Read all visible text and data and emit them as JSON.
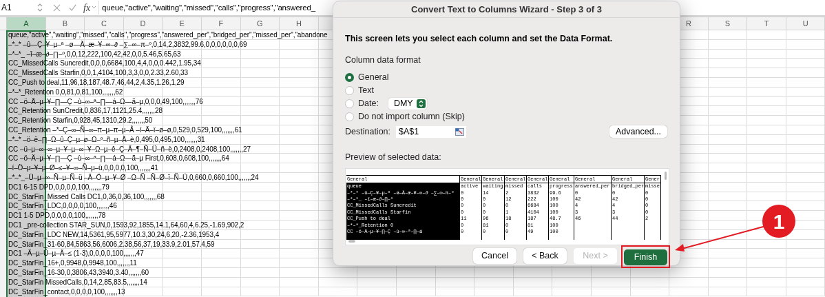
{
  "formula_bar": {
    "name_box": "A1",
    "function_label": "fx",
    "formula": "queue,\"active\",\"waiting\",\"missed\",\"calls\",\"progress\",\"answered_"
  },
  "sheet": {
    "left_columns": [
      {
        "label": "A",
        "selected": true
      },
      {
        "label": "B",
        "selected": false
      },
      {
        "label": "C",
        "selected": false
      },
      {
        "label": "D",
        "selected": false
      },
      {
        "label": "E",
        "selected": false
      },
      {
        "label": "F",
        "selected": false
      },
      {
        "label": "G",
        "selected": false
      },
      {
        "label": "H",
        "selected": false
      }
    ],
    "right_columns": [
      {
        "label": "R",
        "selected": false
      },
      {
        "label": "S",
        "selected": false
      },
      {
        "label": "T",
        "selected": false
      },
      {
        "label": "U",
        "selected": false
      }
    ],
    "rows": [
      "queue,\"active\",\"waiting\",\"missed\",\"calls\",\"progress\",\"answered_per\",\"bridged_per\",\"missed_per\",\"abandone",
      "–*–* –û—Ç–¥–µ–ª –ø—Ä–æ–¥–∞–∂ –∑–∞–π–º,0,14,2,3832,99.6,0,0,0,0,0,0,69",
      "–*–*_ –î–æ–∂–∏–º,0,0,12,222,100,42,42,0,0,5.46,5.65,63",
      "CC_MissedCalls Suncredit,0,0,0,6684,100,4,4,0,0,0.442,1.95,34",
      "CC_MissedCalls Starfin,0,0,1,4104,100,3,3,0,0,2.33,2.60,33",
      "CC_Push to deal,11,96,18,187,48.7,46,44,2,4.35,1.26,1,29",
      "–*–*_Retention 0,0,81,0,81,100,,,,,,,62",
      "CC –ö–Ä–µ–¥–∏—Ç –ù–∞–ª–∏—á–Ω—ã–µ,0,0,0,49,100,,,,,,,76",
      "CC_Retention SunCredit,0,836,17,1121,25.4,,,,,,,28",
      "CC_Retention  Starfin,0,928,45,1310,29.2,,,,,,,50",
      "CC_Retention –*–Ç–∞–Ñ–∞–π–µ–π–µ–Å –í–Ä–ï–ø–ø,0,529,0,529,100,,,,,,,61",
      "–*–* –ö–ë–∏–Ω–û–Ç–µ–ø–Ω–º–ñ–µ–Ä–è,0,495,0,495,100,,,,,,,31",
      "CC –ü–µ–∞–∞–µ–¥–µ–∞–¥–Ω–µ–ê–Ç–Ä–¶–Ñ–Ü–ñ–è,0,2408,0,2408,100,,,,,,,27",
      "CC –ö–Ä–µ–¥–∏—Ç –ù–∞–ª–∏—á–Ω—ã–µ First,0,608,0,608,100,,,,,,,64",
      "–í–Ö–µ–¥–µ–Ø–≤–¥–∞–Ñ–µ–ü,0,0,0,0,100,,,,,,,41",
      "–*–*_–Ü–µ–∞–Ñ–µ–Ñ–ü –Ä–Ö–µ–¥–Ø –Ω–Ñ –Ñ–Ø–ï–Ñ–Ü,0,660,0,660,100,,,,,,,24",
      "DC1 6-15 DPD,0,0,0,0,100,,,,,,,79",
      "DC_StarFin_Missed Calls DC1,0,36,0,36,100,,,,,,,68",
      "DC_StarFin_LDC,0,0,0,0,100,,,,,,,46",
      "DC1 1-5 DPD,0,0,0,0,100,,,,,,,78",
      "DC1 _pre-collection STAR_SUN,0,1593,92,1855,14.1,64,60,4,6.25,-1.69,902,2",
      "DC_StarFin_LDC NEW,14,5361,95,5977,10.3,30,24,6,20,-2.36,1953,4",
      "DC_StarFin_31-60,84,5863,56,6006,2.38,56,37,19,33.9,2.01,57.4,59",
      "DC1 –Ä–µ–Ü–µ–Ä–≤ (1-3),0,0,0,0,100,,,,,,,47",
      "DC_StarFin_16+,0,9948,0,9948,100,,,,,,,11",
      "DC_StarFin_16-30,0,3806,43,3940,3.40,,,,,,,60",
      "DC_StarFin MissedCalls,0,14,2,85,83.5,,,,,,,14",
      "DC_StarFin_contact,0,0,0,0,100,,,,,,,13"
    ]
  },
  "dialog": {
    "title": "Convert Text to Columns Wizard - Step 3 of 3",
    "instruction": "This screen lets you select each column and set the Data Format.",
    "format_heading": "Column data format",
    "options": [
      {
        "kind": "plain",
        "label": "General",
        "selected": true
      },
      {
        "kind": "plain",
        "label": "Text",
        "selected": false
      },
      {
        "kind": "date",
        "label": "Date:",
        "value": "DMY",
        "selected": false
      },
      {
        "kind": "plain",
        "label": "Do not import column (Skip)",
        "selected": false
      }
    ],
    "destination_label": "Destination:",
    "destination_value": "$A$1",
    "advanced_button": "Advanced...",
    "preview_label": "Preview of selected data:",
    "preview_columns": [
      {
        "format": "General",
        "selected": true,
        "values": [
          "queue",
          "–*–* –û—Ç–¥–µ–ª –ø—Ä–æ–¥–∞–∂ –∑–∞–π–º",
          "–*–*_ –î–æ–∂–∏–º",
          "CC_MissedCalls Suncredit",
          "CC_MissedCalls Starfin",
          "CC_Push to deal",
          "–*–*_Retention 0",
          "CC –ö–Ä–µ–¥–∏—Ç –ù–∞–ª–∏—á"
        ]
      },
      {
        "format": "General",
        "selected": false,
        "values": [
          "active",
          "0",
          "0",
          "0",
          "0",
          "11",
          "0",
          "0"
        ]
      },
      {
        "format": "General",
        "selected": false,
        "values": [
          "waiting",
          "14",
          "0",
          "0",
          "0",
          "96",
          "81",
          "0"
        ]
      },
      {
        "format": "General",
        "selected": false,
        "values": [
          "missed",
          "2",
          "12",
          "0",
          "1",
          "18",
          "0",
          "0"
        ]
      },
      {
        "format": "General",
        "selected": false,
        "values": [
          "calls",
          "3832",
          "222",
          "6684",
          "4104",
          "187",
          "81",
          "49"
        ]
      },
      {
        "format": "General",
        "selected": false,
        "values": [
          "progress",
          "99.6",
          "100",
          "100",
          "100",
          "48.7",
          "100",
          "100"
        ]
      },
      {
        "format": "General",
        "selected": false,
        "values": [
          "answered_per",
          "0",
          "42",
          "4",
          "3",
          "46"
        ]
      },
      {
        "format": "General",
        "selected": false,
        "values": [
          "bridged_per",
          "0",
          "42",
          "4",
          "3",
          "44"
        ]
      },
      {
        "format": "Gener",
        "selected": false,
        "values": [
          "misse",
          "0",
          "0",
          "0",
          "0",
          "2"
        ]
      }
    ],
    "buttons": [
      {
        "label": "Cancel",
        "kind": "normal",
        "disabled": false,
        "highlighted": false
      },
      {
        "label": "< Back",
        "kind": "normal",
        "disabled": false,
        "highlighted": false
      },
      {
        "label": "Next >",
        "kind": "normal",
        "disabled": true,
        "highlighted": false
      },
      {
        "label": "Finish",
        "kind": "primary",
        "disabled": false,
        "highlighted": true
      }
    ]
  },
  "annotation": {
    "label": "1"
  }
}
